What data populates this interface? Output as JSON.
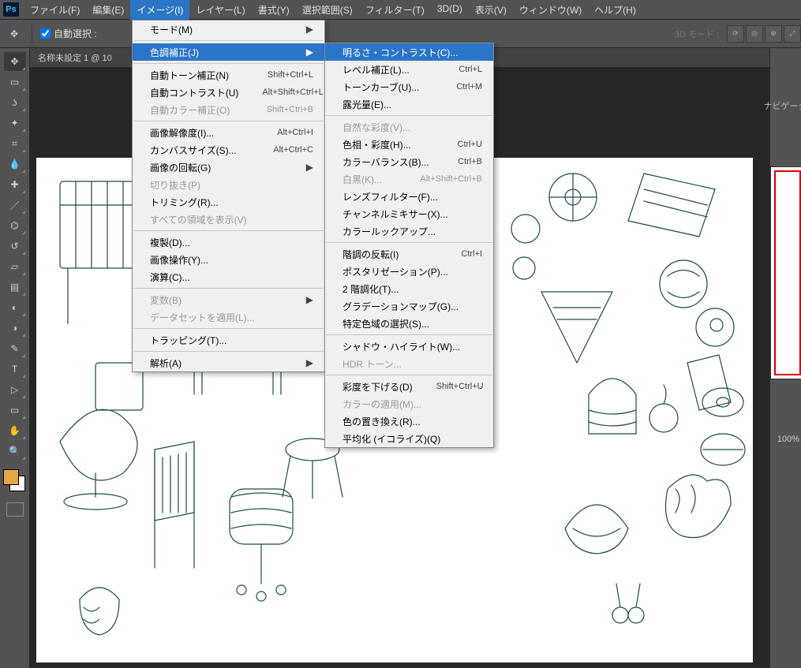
{
  "menubar": {
    "items": [
      {
        "label": "ファイル(F)"
      },
      {
        "label": "編集(E)"
      },
      {
        "label": "イメージ(I)",
        "active": true
      },
      {
        "label": "レイヤー(L)"
      },
      {
        "label": "書式(Y)"
      },
      {
        "label": "選択範囲(S)"
      },
      {
        "label": "フィルター(T)"
      },
      {
        "label": "3D(D)"
      },
      {
        "label": "表示(V)"
      },
      {
        "label": "ウィンドウ(W)"
      },
      {
        "label": "ヘルプ(H)"
      }
    ]
  },
  "optionsbar": {
    "auto_select_label": "自動選択 :",
    "mode3d_label": "3D モード :"
  },
  "document": {
    "tab_label": "名称未設定 1 @ 10"
  },
  "rightpanel": {
    "navigator_label": "ナビゲータ",
    "zoom_label": "100%"
  },
  "image_menu": {
    "groups": [
      [
        {
          "label": "モード(M)",
          "sub": true
        }
      ],
      [
        {
          "label": "色調補正(J)",
          "sub": true,
          "hover": true
        }
      ],
      [
        {
          "label": "自動トーン補正(N)",
          "shortcut": "Shift+Ctrl+L"
        },
        {
          "label": "自動コントラスト(U)",
          "shortcut": "Alt+Shift+Ctrl+L"
        },
        {
          "label": "自動カラー補正(O)",
          "shortcut": "Shift+Ctrl+B",
          "disabled": true
        }
      ],
      [
        {
          "label": "画像解像度(I)...",
          "shortcut": "Alt+Ctrl+I"
        },
        {
          "label": "カンバスサイズ(S)...",
          "shortcut": "Alt+Ctrl+C"
        },
        {
          "label": "画像の回転(G)",
          "sub": true
        },
        {
          "label": "切り抜き(P)",
          "disabled": true
        },
        {
          "label": "トリミング(R)..."
        },
        {
          "label": "すべての領域を表示(V)",
          "disabled": true
        }
      ],
      [
        {
          "label": "複製(D)..."
        },
        {
          "label": "画像操作(Y)..."
        },
        {
          "label": "演算(C)..."
        }
      ],
      [
        {
          "label": "変数(B)",
          "sub": true,
          "disabled": true
        },
        {
          "label": "データセットを適用(L)...",
          "disabled": true
        }
      ],
      [
        {
          "label": "トラッピング(T)..."
        }
      ],
      [
        {
          "label": "解析(A)",
          "sub": true
        }
      ]
    ]
  },
  "adjust_menu": {
    "groups": [
      [
        {
          "label": "明るさ・コントラスト(C)...",
          "hover": true
        },
        {
          "label": "レベル補正(L)...",
          "shortcut": "Ctrl+L"
        },
        {
          "label": "トーンカーブ(U)...",
          "shortcut": "Ctrl+M"
        },
        {
          "label": "露光量(E)..."
        }
      ],
      [
        {
          "label": "自然な彩度(V)...",
          "disabled": true
        },
        {
          "label": "色相・彩度(H)...",
          "shortcut": "Ctrl+U"
        },
        {
          "label": "カラーバランス(B)...",
          "shortcut": "Ctrl+B"
        },
        {
          "label": "白黒(K)...",
          "shortcut": "Alt+Shift+Ctrl+B",
          "disabled": true
        },
        {
          "label": "レンズフィルター(F)..."
        },
        {
          "label": "チャンネルミキサー(X)..."
        },
        {
          "label": "カラールックアップ..."
        }
      ],
      [
        {
          "label": "階調の反転(I)",
          "shortcut": "Ctrl+I"
        },
        {
          "label": "ポスタリゼーション(P)..."
        },
        {
          "label": "2 階調化(T)..."
        },
        {
          "label": "グラデーションマップ(G)..."
        },
        {
          "label": "特定色域の選択(S)..."
        }
      ],
      [
        {
          "label": "シャドウ・ハイライト(W)..."
        },
        {
          "label": "HDR トーン...",
          "disabled": true
        }
      ],
      [
        {
          "label": "彩度を下げる(D)",
          "shortcut": "Shift+Ctrl+U"
        },
        {
          "label": "カラーの適用(M)...",
          "disabled": true
        },
        {
          "label": "色の置き換え(R)..."
        },
        {
          "label": "平均化 (イコライズ)(Q)"
        }
      ]
    ]
  },
  "tools": [
    "move",
    "marquee",
    "lasso",
    "magic-wand",
    "crop",
    "eyedropper",
    "spot-heal",
    "brush",
    "clone",
    "history-brush",
    "eraser",
    "gradient",
    "blur",
    "dodge",
    "pen",
    "type",
    "path-select",
    "rectangle",
    "hand",
    "zoom"
  ]
}
